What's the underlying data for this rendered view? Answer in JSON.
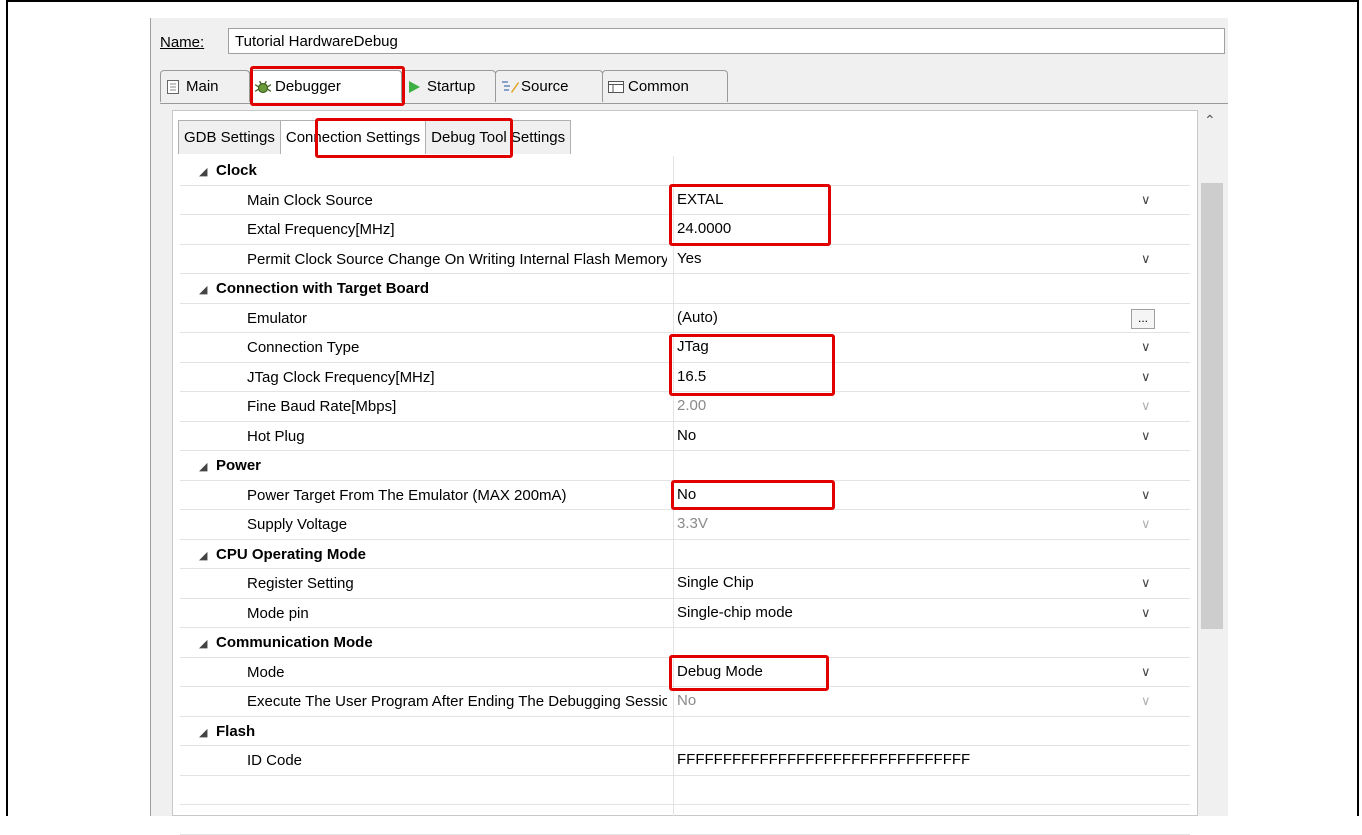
{
  "name_label": "Name:",
  "name_value": "Tutorial HardwareDebug",
  "outer_tabs": [
    {
      "label": "Main",
      "icon": "document-icon"
    },
    {
      "label": "Debugger",
      "icon": "bug-icon"
    },
    {
      "label": "Startup",
      "icon": "play-icon"
    },
    {
      "label": "Source",
      "icon": "source-icon"
    },
    {
      "label": "Common",
      "icon": "table-icon"
    }
  ],
  "inner_tabs": [
    "GDB Settings",
    "Connection Settings",
    "Debug Tool Settings"
  ],
  "rows": [
    {
      "type": "cat",
      "label": "Clock"
    },
    {
      "type": "prop",
      "label": "Main Clock Source",
      "value": "EXTAL",
      "control": "dropdown"
    },
    {
      "type": "prop",
      "label": "Extal Frequency[MHz]",
      "value": "24.0000",
      "control": "text"
    },
    {
      "type": "prop",
      "label": "Permit Clock Source Change On Writing Internal Flash Memory",
      "value": "Yes",
      "control": "dropdown"
    },
    {
      "type": "cat",
      "label": "Connection with Target Board"
    },
    {
      "type": "prop",
      "label": "Emulator",
      "value": "(Auto)",
      "control": "browse"
    },
    {
      "type": "prop",
      "label": "Connection Type",
      "value": "JTag",
      "control": "dropdown"
    },
    {
      "type": "prop",
      "label": "JTag Clock Frequency[MHz]",
      "value": "16.5",
      "control": "dropdown"
    },
    {
      "type": "prop",
      "label": "Fine Baud Rate[Mbps]",
      "value": "2.00",
      "control": "dropdown",
      "disabled": true
    },
    {
      "type": "prop",
      "label": "Hot Plug",
      "value": "No",
      "control": "dropdown"
    },
    {
      "type": "cat",
      "label": "Power"
    },
    {
      "type": "prop",
      "label": "Power Target From The Emulator (MAX 200mA)",
      "value": "No",
      "control": "dropdown"
    },
    {
      "type": "prop",
      "label": "Supply Voltage",
      "value": "3.3V",
      "control": "dropdown",
      "disabled": true
    },
    {
      "type": "cat",
      "label": "CPU Operating Mode"
    },
    {
      "type": "prop",
      "label": "Register Setting",
      "value": "Single Chip",
      "control": "dropdown"
    },
    {
      "type": "prop",
      "label": "Mode pin",
      "value": "Single-chip mode",
      "control": "dropdown"
    },
    {
      "type": "cat",
      "label": "Communication Mode"
    },
    {
      "type": "prop",
      "label": "Mode",
      "value": "Debug Mode",
      "control": "dropdown"
    },
    {
      "type": "prop",
      "label": "Execute The User Program After Ending The Debugging Session",
      "value": "No",
      "control": "dropdown",
      "disabled": true
    },
    {
      "type": "cat",
      "label": "Flash"
    },
    {
      "type": "prop",
      "label": "ID Code",
      "value": "FFFFFFFFFFFFFFFFFFFFFFFFFFFFFFFF",
      "control": "text"
    },
    {
      "type": "empty"
    },
    {
      "type": "empty"
    }
  ],
  "browse_label": "...",
  "dropdown_icon": "chevron-down-icon",
  "scroll_up_icon": "chevron-up-icon",
  "highlight_color": "#e00000"
}
